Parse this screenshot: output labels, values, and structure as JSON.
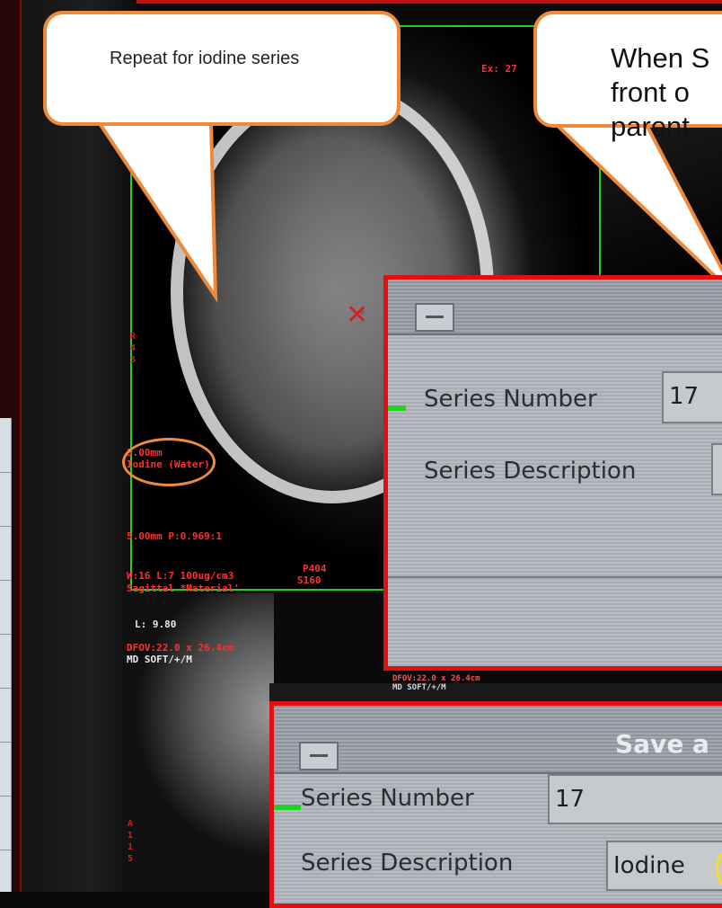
{
  "callouts": {
    "left_text": "Repeat for iodine series",
    "right_text": "When S\nfront o\nparent"
  },
  "overlay": {
    "ex_label": "Ex: 27",
    "thickness": "3.00mm",
    "material": "Iodine (Water)",
    "slice_info": "5.00mm P:0.969:1",
    "window": "W:16 L:7 100ug/cm3",
    "view": "Sagittal *Material'",
    "series_code": "S160",
    "side_code": "P404",
    "level": "L: 9.80",
    "dfov": "DFOV:22.0 x 26.4cm",
    "recon": "MD SOFT/+/M",
    "dfov_small": "DFOV:22.0 x 26.4cm",
    "recon_small": "MD SOFT/+/M",
    "left_marks": "A\n1\n1\n5",
    "left_marks_top": "R\n4\n3"
  },
  "dialog1": {
    "series_number_label": "Series Number",
    "series_number_value": "17",
    "series_description_label": "Series Description"
  },
  "dialog2": {
    "title": "Save a",
    "series_number_label": "Series Number",
    "series_number_value": "17",
    "series_description_label": "Series Description",
    "series_description_value": "Iodine"
  },
  "colors": {
    "callout_border": "#ef8a3a",
    "dialog_border": "#e01010",
    "overlay_text": "#ff3030",
    "viewport_border": "#22d022"
  }
}
